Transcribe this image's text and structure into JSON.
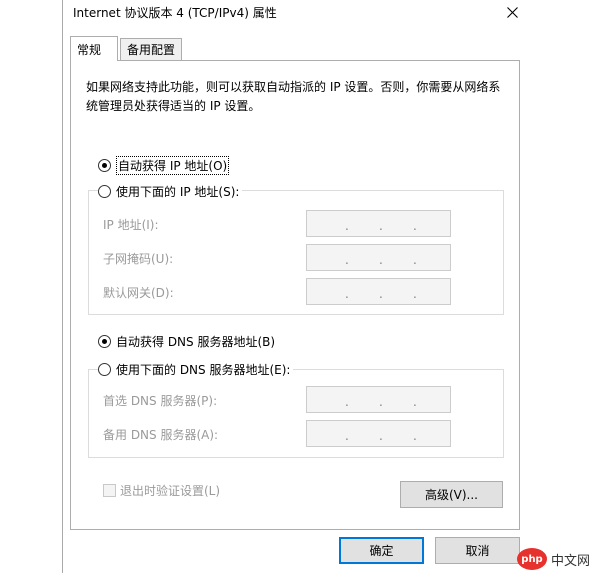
{
  "window": {
    "title": "Internet 协议版本 4 (TCP/IPv4) 属性"
  },
  "tabs": [
    {
      "label": "常规"
    },
    {
      "label": "备用配置"
    }
  ],
  "description": "如果网络支持此功能，则可以获取自动指派的 IP 设置。否则，你需要从网络系统管理员处获得适当的 IP 设置。",
  "ip_section": {
    "auto_label": "自动获得 IP 地址(O)",
    "manual_label": "使用下面的 IP 地址(S):",
    "fields": [
      {
        "label": "IP 地址(I):"
      },
      {
        "label": "子网掩码(U):"
      },
      {
        "label": "默认网关(D):"
      }
    ]
  },
  "dns_section": {
    "auto_label": "自动获得 DNS 服务器地址(B)",
    "manual_label": "使用下面的 DNS 服务器地址(E):",
    "fields": [
      {
        "label": "首选 DNS 服务器(P):"
      },
      {
        "label": "备用 DNS 服务器(A):"
      }
    ]
  },
  "ip_separator": ".",
  "validate_label": "退出时验证设置(L)",
  "buttons": {
    "advanced": "高级(V)...",
    "ok": "确定",
    "cancel": "取消"
  },
  "watermark": {
    "logo": "php",
    "text": "中文网"
  },
  "colors": {
    "accent": "#0078d7",
    "watermark": "#e6312d"
  }
}
